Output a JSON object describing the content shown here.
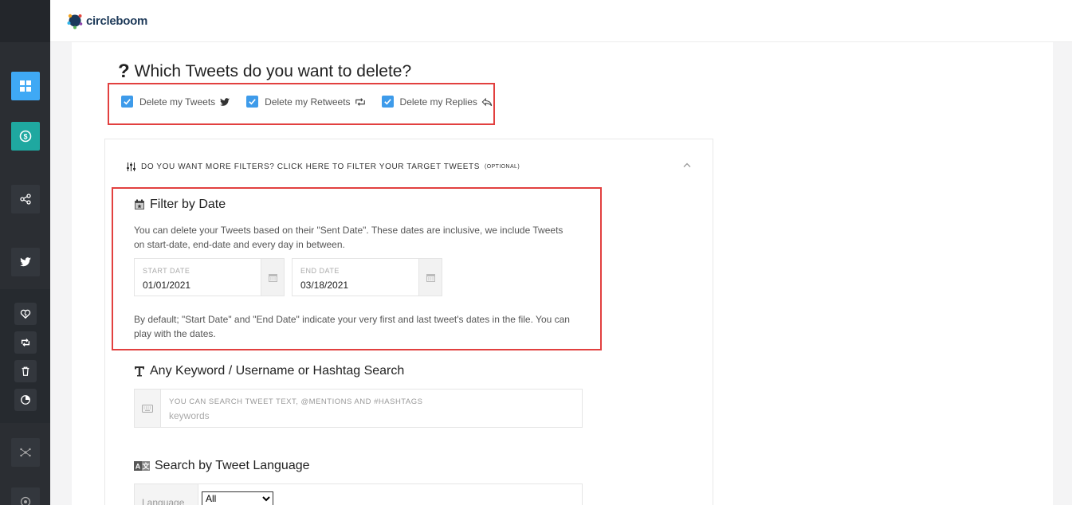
{
  "brand": {
    "name": "circleboom"
  },
  "sidebar": {
    "items": [
      {
        "icon": "dashboard-icon",
        "active": true,
        "color": "#3fa9f5"
      },
      {
        "icon": "dollar-icon",
        "active": true,
        "color": "#1fa8a0"
      },
      {
        "icon": "share-icon"
      },
      {
        "icon": "twitter-icon"
      },
      {
        "icon": "heart-broken-icon"
      },
      {
        "icon": "retweet-icon"
      },
      {
        "icon": "trash-icon"
      },
      {
        "icon": "pie-icon"
      },
      {
        "icon": "network-icon"
      },
      {
        "icon": "circle-icon"
      }
    ]
  },
  "question": {
    "mark": "?",
    "title": "Which Tweets do you want to delete?"
  },
  "checkboxes": [
    {
      "label": "Delete my Tweets",
      "checked": true,
      "icon": "twitter-icon"
    },
    {
      "label": "Delete my Retweets",
      "checked": true,
      "icon": "retweet-icon"
    },
    {
      "label": "Delete my Replies",
      "checked": true,
      "icon": "reply-icon"
    }
  ],
  "filters": {
    "header": "DO YOU WANT MORE FILTERS? CLICK HERE TO FILTER YOUR TARGET TWEETS",
    "optional": "(OPTIONAL)"
  },
  "date_filter": {
    "title": "Filter by Date",
    "description": "You can delete your Tweets based on their \"Sent Date\". These dates are inclusive, we include Tweets on start-date, end-date and every day in between.",
    "start_label": "START DATE",
    "start_value": "01/01/2021",
    "end_label": "END DATE",
    "end_value": "03/18/2021",
    "note": "By default; \"Start Date\" and \"End Date\" indicate your very first and last tweet's dates in the file. You can play with the dates."
  },
  "keyword_filter": {
    "title": "Any Keyword / Username or Hashtag Search",
    "label": "YOU CAN SEARCH TWEET TEXT, @MENTIONS AND #HASHTAGS",
    "placeholder": "keywords"
  },
  "language_filter": {
    "title": "Search by Tweet Language",
    "label": "Language",
    "selected": "All"
  },
  "colors": {
    "accent": "#3e9bea",
    "highlight": "#e2403f"
  }
}
